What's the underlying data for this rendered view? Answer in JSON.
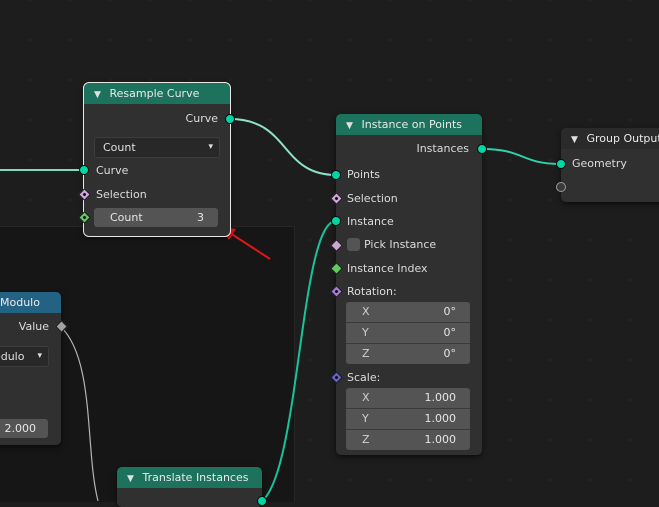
{
  "resample": {
    "title": "Resample Curve",
    "out_curve": "Curve",
    "mode": "Count",
    "in_curve": "Curve",
    "selection": "Selection",
    "count_label": "Count",
    "count_value": "3"
  },
  "instance": {
    "title": "Instance on Points",
    "out_instances": "Instances",
    "points": "Points",
    "selection": "Selection",
    "instance": "Instance",
    "pick_instance": "Pick Instance",
    "instance_index": "Instance Index",
    "rotation": "Rotation:",
    "rot_x_label": "X",
    "rot_x": "0°",
    "rot_y_label": "Y",
    "rot_y": "0°",
    "rot_z_label": "Z",
    "rot_z": "0°",
    "scale": "Scale:",
    "sc_x_label": "X",
    "sc_x": "1.000",
    "sc_y_label": "Y",
    "sc_y": "1.000",
    "sc_z_label": "Z",
    "sc_z": "1.000"
  },
  "group_output": {
    "title": "Group Output",
    "geometry": "Geometry"
  },
  "math": {
    "title": "Modulo",
    "value": "Value",
    "mode": "odulo",
    "field_value": "2.000"
  },
  "translate": {
    "title": "Translate Instances",
    "partial": "Instances"
  },
  "colors": {
    "geometry_header": "#1d725e",
    "utility_header": "#246283",
    "geometry_socket": "#00d6a3",
    "annotation_arrow": "#e01515"
  }
}
